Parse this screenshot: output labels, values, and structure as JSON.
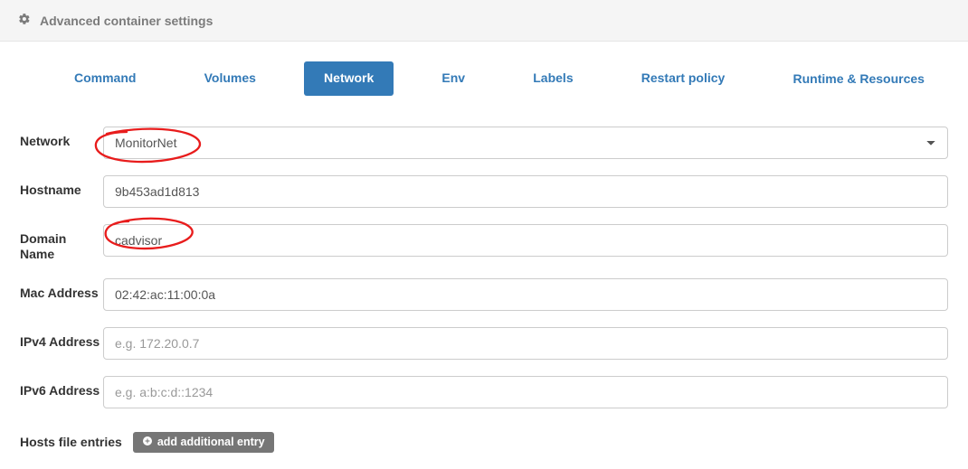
{
  "header": {
    "title": "Advanced container settings"
  },
  "tabs": {
    "command": "Command",
    "volumes": "Volumes",
    "network": "Network",
    "env": "Env",
    "labels": "Labels",
    "restart_policy": "Restart policy",
    "runtime_resources": "Runtime &\nResources"
  },
  "form": {
    "network": {
      "label": "Network",
      "value": "MonitorNet"
    },
    "hostname": {
      "label": "Hostname",
      "value": "9b453ad1d813"
    },
    "domain_name": {
      "label": "Domain Name",
      "value": "cadvisor"
    },
    "mac_address": {
      "label": "Mac Address",
      "value": "02:42:ac:11:00:0a"
    },
    "ipv4_address": {
      "label": "IPv4 Address",
      "value": "",
      "placeholder": "e.g. 172.20.0.7"
    },
    "ipv6_address": {
      "label": "IPv6 Address",
      "value": "",
      "placeholder": "e.g. a:b:c:d::1234"
    }
  },
  "hosts": {
    "label": "Hosts file entries",
    "add_button": "add additional entry"
  },
  "colors": {
    "primary": "#337ab7",
    "header_bg": "#f5f5f5",
    "button_gray": "#767676"
  }
}
